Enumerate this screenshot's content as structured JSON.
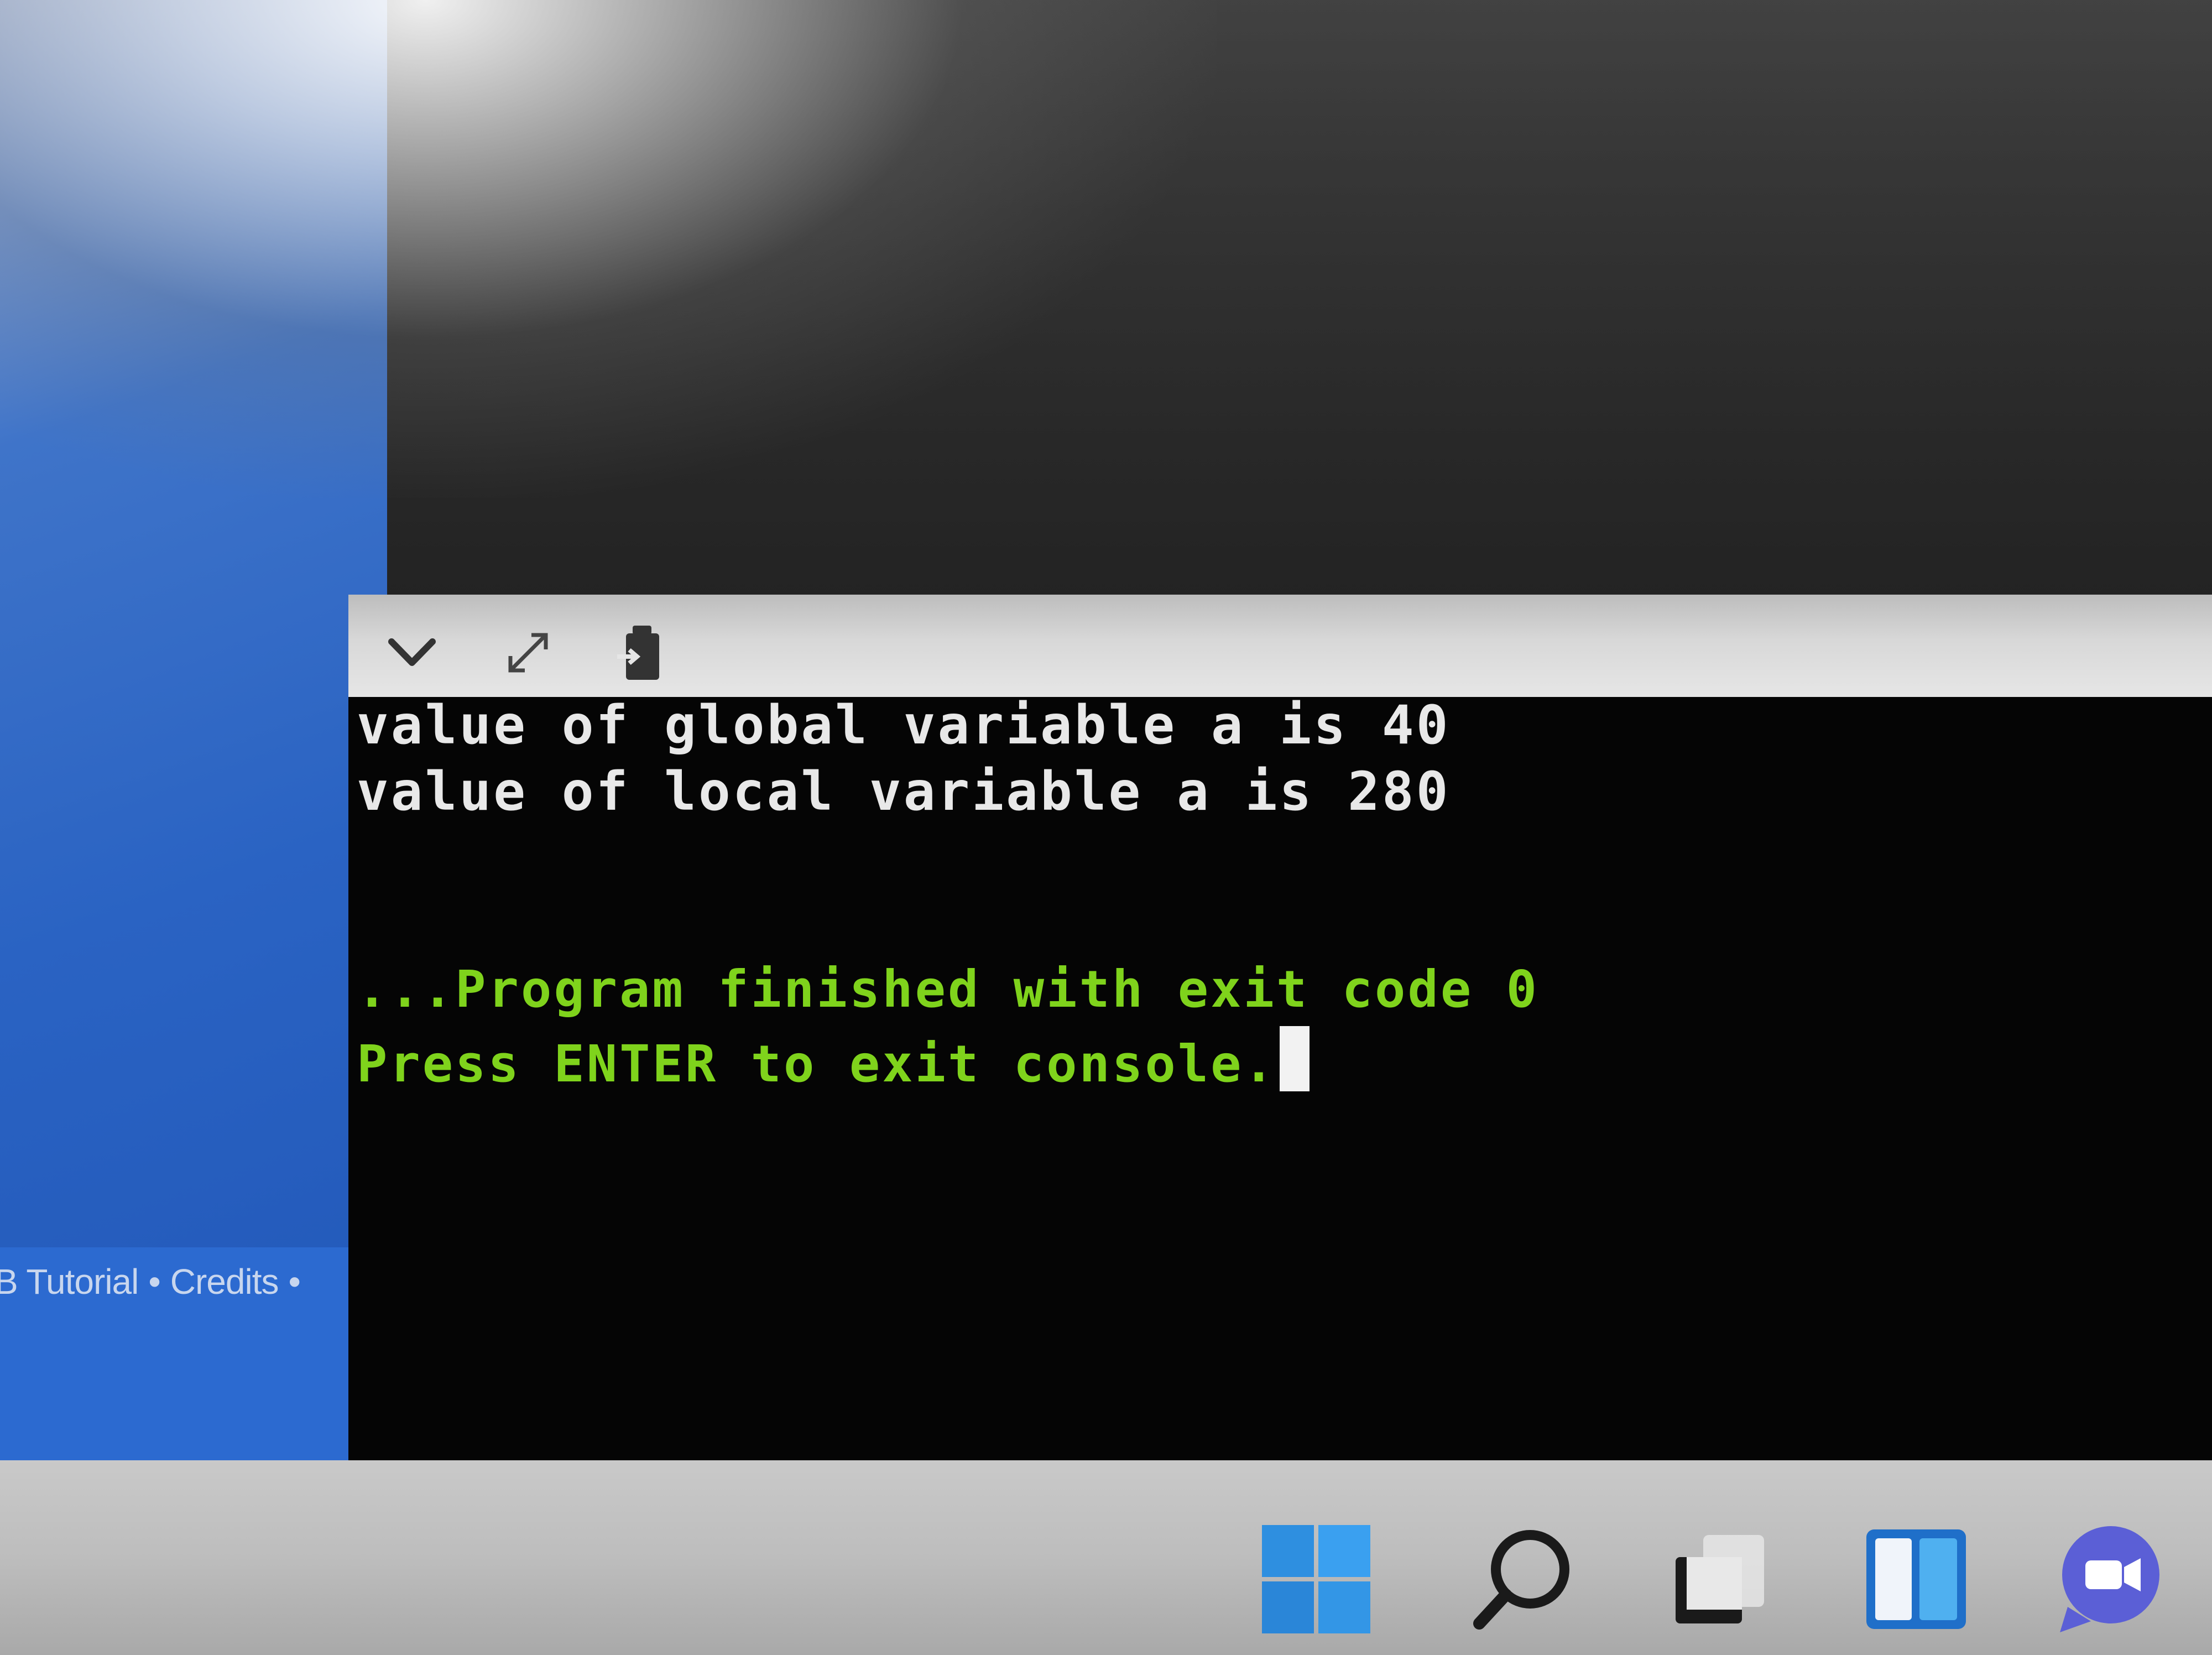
{
  "sidebar": {
    "footer_links": [
      "B Tutorial",
      "Credits"
    ],
    "separator": "•"
  },
  "console_toolbar": {
    "icons": [
      "chevron-down-icon",
      "expand-icon",
      "clear-console-icon"
    ]
  },
  "console": {
    "output_lines": [
      "value of global variable a is 40",
      "value of local variable a is 280"
    ],
    "status_lines": [
      "...Program finished with exit code 0",
      "Press ENTER to exit console."
    ],
    "output_color": "#e8e8e8",
    "status_color": "#7fd31c",
    "background_color": "#050505"
  },
  "taskbar": {
    "icons": [
      "windows-start-icon",
      "search-icon",
      "task-view-icon",
      "widgets-icon",
      "teams-chat-icon"
    ],
    "accent_color": "#2e8fe0"
  }
}
